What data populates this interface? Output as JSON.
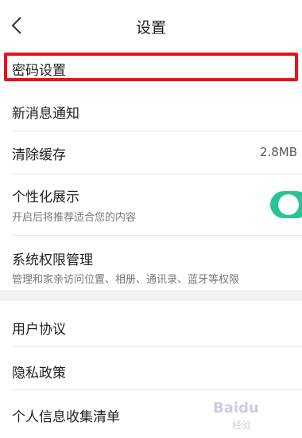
{
  "header": {
    "title": "设置"
  },
  "settings": {
    "password": {
      "label": "密码设置"
    },
    "notification": {
      "label": "新消息通知"
    },
    "clear_cache": {
      "label": "清除缓存",
      "value": "2.8MB"
    },
    "personalized": {
      "label": "个性化展示",
      "description": "开启后将推荐适合您的内容",
      "enabled": true
    },
    "permissions": {
      "label": "系统权限管理",
      "description": "管理和家亲访问位置、相册、通讯录、蓝牙等权限"
    },
    "user_agreement": {
      "label": "用户协议"
    },
    "privacy_policy": {
      "label": "隐私政策"
    },
    "personal_info": {
      "label": "个人信息收集清单"
    }
  },
  "colors": {
    "highlight": "#e8101c",
    "toggle_on": "#26c597",
    "section_gap": "#f2f2f2"
  },
  "watermark": {
    "text": "Baidu",
    "sub": "经验"
  }
}
